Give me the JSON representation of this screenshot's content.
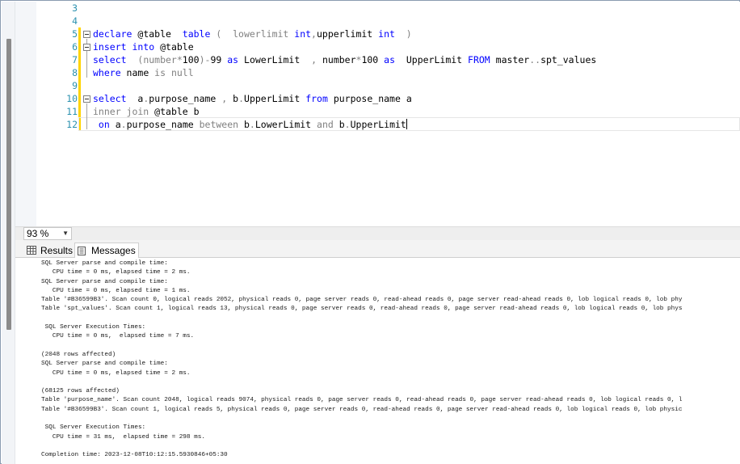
{
  "editor": {
    "line_numbers": [
      "3",
      "4",
      "5",
      "6",
      "7",
      "8",
      "9",
      "10",
      "11",
      "12"
    ],
    "lines": [
      [],
      [],
      [
        {
          "t": "declare ",
          "c": "kw"
        },
        {
          "t": "@table  ",
          "c": ""
        },
        {
          "t": "table ",
          "c": "kw"
        },
        {
          "t": "(  lowerlimit ",
          "c": "gr"
        },
        {
          "t": "int",
          "c": "kw"
        },
        {
          "t": ",",
          "c": "gr"
        },
        {
          "t": "upperlimit ",
          "c": ""
        },
        {
          "t": "int  ",
          "c": "kw"
        },
        {
          "t": ")",
          "c": "gr"
        }
      ],
      [
        {
          "t": "insert into ",
          "c": "kw"
        },
        {
          "t": "@table",
          "c": ""
        }
      ],
      [
        {
          "t": "select  ",
          "c": "kw"
        },
        {
          "t": "(number",
          "c": "gr"
        },
        {
          "t": "*",
          "c": "gr"
        },
        {
          "t": "100",
          "c": ""
        },
        {
          "t": ")",
          "c": "gr"
        },
        {
          "t": "-",
          "c": "gr"
        },
        {
          "t": "99 ",
          "c": ""
        },
        {
          "t": "as ",
          "c": "kw"
        },
        {
          "t": "LowerLimit  ",
          "c": ""
        },
        {
          "t": ", ",
          "c": "gr"
        },
        {
          "t": "number",
          "c": ""
        },
        {
          "t": "*",
          "c": "gr"
        },
        {
          "t": "100 ",
          "c": ""
        },
        {
          "t": "as  ",
          "c": "kw"
        },
        {
          "t": "UpperLimit ",
          "c": ""
        },
        {
          "t": "FROM ",
          "c": "kw"
        },
        {
          "t": "master",
          "c": ""
        },
        {
          "t": "..",
          "c": "gr"
        },
        {
          "t": "spt_values",
          "c": ""
        }
      ],
      [
        {
          "t": "where ",
          "c": "kw"
        },
        {
          "t": "name ",
          "c": ""
        },
        {
          "t": "is null",
          "c": "gr"
        }
      ],
      [],
      [
        {
          "t": "select  ",
          "c": "kw"
        },
        {
          "t": "a",
          "c": ""
        },
        {
          "t": ".",
          "c": "gr"
        },
        {
          "t": "purpose_name ",
          "c": ""
        },
        {
          "t": ", ",
          "c": "gr"
        },
        {
          "t": "b",
          "c": ""
        },
        {
          "t": ".",
          "c": "gr"
        },
        {
          "t": "UpperLimit ",
          "c": ""
        },
        {
          "t": "from ",
          "c": "kw"
        },
        {
          "t": "purpose_name a",
          "c": ""
        }
      ],
      [
        {
          "t": "inner join ",
          "c": "gr"
        },
        {
          "t": "@table b",
          "c": ""
        }
      ],
      [
        {
          "t": " on ",
          "c": "kw"
        },
        {
          "t": "a",
          "c": ""
        },
        {
          "t": ".",
          "c": "gr"
        },
        {
          "t": "purpose_name ",
          "c": ""
        },
        {
          "t": "between ",
          "c": "gr"
        },
        {
          "t": "b",
          "c": ""
        },
        {
          "t": ".",
          "c": "gr"
        },
        {
          "t": "LowerLimit ",
          "c": ""
        },
        {
          "t": "and ",
          "c": "gr"
        },
        {
          "t": "b",
          "c": ""
        },
        {
          "t": ".",
          "c": "gr"
        },
        {
          "t": "UpperLimit",
          "c": ""
        }
      ]
    ]
  },
  "zoom": {
    "value": "93 %"
  },
  "tabs": {
    "results": "Results",
    "messages": "Messages"
  },
  "messages": [
    "SQL Server parse and compile time:",
    "   CPU time = 0 ms, elapsed time = 2 ms.",
    "SQL Server parse and compile time:",
    "   CPU time = 0 ms, elapsed time = 1 ms.",
    "Table '#B36599B3'. Scan count 0, logical reads 2052, physical reads 0, page server reads 0, read-ahead reads 0, page server read-ahead reads 0, lob logical reads 0, lob phy",
    "Table 'spt_values'. Scan count 1, logical reads 13, physical reads 0, page server reads 0, read-ahead reads 0, page server read-ahead reads 0, lob logical reads 0, lob phys",
    "",
    " SQL Server Execution Times:",
    "   CPU time = 0 ms,  elapsed time = 7 ms.",
    "",
    "(2048 rows affected)",
    "SQL Server parse and compile time:",
    "   CPU time = 0 ms, elapsed time = 2 ms.",
    "",
    "(68125 rows affected)",
    "Table 'purpose_name'. Scan count 2048, logical reads 9074, physical reads 0, page server reads 0, read-ahead reads 0, page server read-ahead reads 0, lob logical reads 0, l",
    "Table '#B36599B3'. Scan count 1, logical reads 5, physical reads 0, page server reads 0, read-ahead reads 0, page server read-ahead reads 0, lob logical reads 0, lob physic",
    "",
    " SQL Server Execution Times:",
    "   CPU time = 31 ms,  elapsed time = 298 ms.",
    "",
    "Completion time: 2023-12-08T10:12:15.5930846+05:30"
  ],
  "colors": {
    "keyword": "#0000ff",
    "gray": "#808080",
    "line_number": "#2b91af",
    "change_bar": "#ffd400"
  }
}
